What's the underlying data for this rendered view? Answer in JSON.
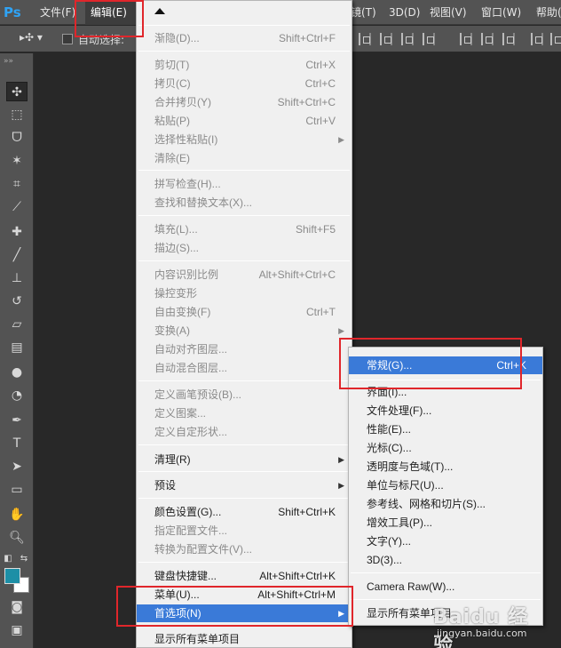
{
  "app": {
    "logo": "Ps"
  },
  "menubar": {
    "file": "文件(F)",
    "edit": "编辑(E)",
    "image": "镜(T)",
    "threed": "3D(D)",
    "view": "视图(V)",
    "window": "窗口(W)",
    "help": "帮助("
  },
  "options": {
    "move_tool": "▸✣ ▾",
    "auto_select_label": "自动选择:"
  },
  "edit_menu": {
    "items": [
      {
        "label": "渐隐(D)...",
        "shortcut": "Shift+Ctrl+F",
        "enabled": false
      },
      {
        "label": "剪切(T)",
        "shortcut": "Ctrl+X",
        "enabled": false
      },
      {
        "label": "拷贝(C)",
        "shortcut": "Ctrl+C",
        "enabled": false
      },
      {
        "label": "合并拷贝(Y)",
        "shortcut": "Shift+Ctrl+C",
        "enabled": false
      },
      {
        "label": "粘贴(P)",
        "shortcut": "Ctrl+V",
        "enabled": false
      },
      {
        "label": "选择性粘贴(I)",
        "shortcut": "",
        "enabled": false,
        "submenu": true
      },
      {
        "label": "清除(E)",
        "shortcut": "",
        "enabled": false
      },
      {
        "label": "拼写检查(H)...",
        "shortcut": "",
        "enabled": false
      },
      {
        "label": "查找和替换文本(X)...",
        "shortcut": "",
        "enabled": false
      },
      {
        "label": "填充(L)...",
        "shortcut": "Shift+F5",
        "enabled": false
      },
      {
        "label": "描边(S)...",
        "shortcut": "",
        "enabled": false
      },
      {
        "label": "内容识别比例",
        "shortcut": "Alt+Shift+Ctrl+C",
        "enabled": false
      },
      {
        "label": "操控变形",
        "shortcut": "",
        "enabled": false
      },
      {
        "label": "自由变换(F)",
        "shortcut": "Ctrl+T",
        "enabled": false
      },
      {
        "label": "变换(A)",
        "shortcut": "",
        "enabled": false,
        "submenu": true
      },
      {
        "label": "自动对齐图层...",
        "shortcut": "",
        "enabled": false
      },
      {
        "label": "自动混合图层...",
        "shortcut": "",
        "enabled": false
      },
      {
        "label": "定义画笔预设(B)...",
        "shortcut": "",
        "enabled": false
      },
      {
        "label": "定义图案...",
        "shortcut": "",
        "enabled": false
      },
      {
        "label": "定义自定形状...",
        "shortcut": "",
        "enabled": false
      },
      {
        "label": "清理(R)",
        "shortcut": "",
        "enabled": true,
        "submenu": true
      },
      {
        "label": "预设",
        "shortcut": "",
        "enabled": true,
        "submenu": true
      },
      {
        "label": "颜色设置(G)...",
        "shortcut": "Shift+Ctrl+K",
        "enabled": true
      },
      {
        "label": "指定配置文件...",
        "shortcut": "",
        "enabled": false
      },
      {
        "label": "转换为配置文件(V)...",
        "shortcut": "",
        "enabled": false
      },
      {
        "label": "键盘快捷键...",
        "shortcut": "Alt+Shift+Ctrl+K",
        "enabled": true
      },
      {
        "label": "菜单(U)...",
        "shortcut": "Alt+Shift+Ctrl+M",
        "enabled": true
      },
      {
        "label": "首选项(N)",
        "shortcut": "",
        "enabled": true,
        "submenu": true,
        "highlighted": true
      },
      {
        "label": "显示所有菜单项目",
        "shortcut": "",
        "enabled": true
      }
    ]
  },
  "prefs_menu": {
    "items": [
      {
        "label": "常规(G)...",
        "shortcut": "Ctrl+K",
        "highlighted": true
      },
      {
        "label": "界面(I)...",
        "shortcut": ""
      },
      {
        "label": "文件处理(F)...",
        "shortcut": ""
      },
      {
        "label": "性能(E)...",
        "shortcut": ""
      },
      {
        "label": "光标(C)...",
        "shortcut": ""
      },
      {
        "label": "透明度与色域(T)...",
        "shortcut": ""
      },
      {
        "label": "单位与标尺(U)...",
        "shortcut": ""
      },
      {
        "label": "参考线、网格和切片(S)...",
        "shortcut": ""
      },
      {
        "label": "增效工具(P)...",
        "shortcut": ""
      },
      {
        "label": "文字(Y)...",
        "shortcut": ""
      },
      {
        "label": "3D(3)...",
        "shortcut": ""
      },
      {
        "label": "Camera Raw(W)...",
        "shortcut": ""
      },
      {
        "label": "显示所有菜单项目",
        "shortcut": ""
      }
    ]
  },
  "watermark": {
    "main": "Baidu 经验",
    "sub": "jingyan.baidu.com"
  },
  "colors": {
    "highlight": "#3a7ad8",
    "annotation": "#e0262b",
    "foreground_swatch": "#1d8fa6",
    "background_swatch": "#ffffff"
  },
  "tools": [
    "move-icon",
    "marquee-icon",
    "lasso-icon",
    "magic-wand-icon",
    "crop-icon",
    "eyedropper-icon",
    "healing-brush-icon",
    "brush-icon",
    "clone-stamp-icon",
    "history-brush-icon",
    "eraser-icon",
    "gradient-icon",
    "blur-icon",
    "dodge-icon",
    "pen-icon",
    "type-icon",
    "path-selection-icon",
    "shape-icon",
    "hand-icon",
    "zoom-icon"
  ]
}
